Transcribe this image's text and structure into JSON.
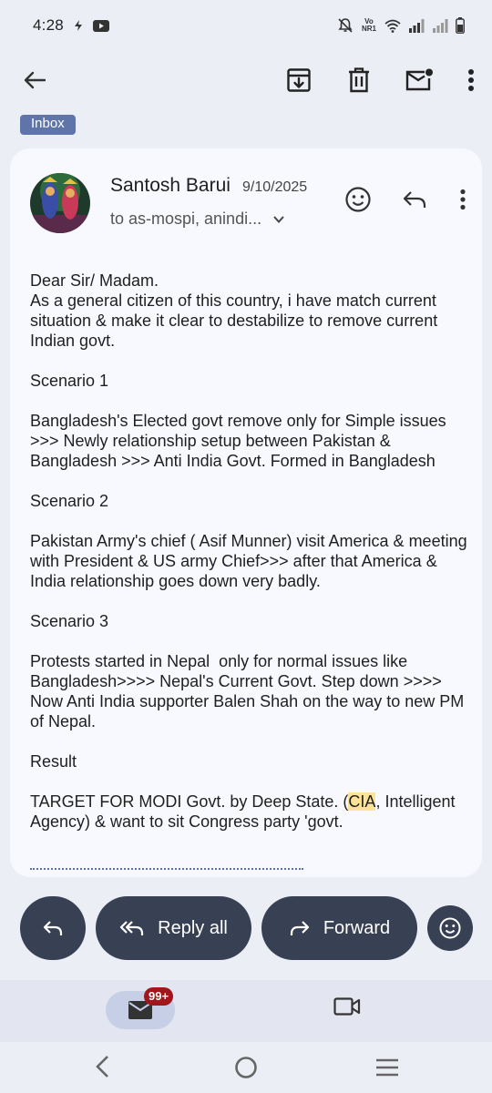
{
  "status_bar": {
    "time": "4:28",
    "network_label": "Vo NR1"
  },
  "app_bar": {
    "icons": [
      "back-arrow-icon",
      "archive-icon",
      "delete-icon",
      "mark-unread-icon",
      "more-vert-icon"
    ]
  },
  "label_chip": "Inbox",
  "email": {
    "sender": "Santosh Barui",
    "date": "9/10/2025",
    "recipients": "to as-mospi, anindi...",
    "body_lines": [
      "Dear Sir/ Madam.",
      "As a general citizen of this country, i have match current situation & make it clear to destabilize to remove current Indian govt.",
      "",
      "Scenario 1",
      "",
      "Bangladesh's Elected govt remove only for Simple issues >>> Newly relationship setup between Pakistan & Bangladesh >>> Anti India Govt. Formed in Bangladesh",
      "",
      "Scenario 2",
      "",
      "Pakistan Army's chief ( Asif Munner) visit America & meeting with President & US army Chief>>> after that America & India relationship goes down very badly.",
      "",
      "Scenario 3",
      "",
      "Protests started in Nepal  only for normal issues like Bangladesh>>>> Nepal's Current Govt. Step down >>>> Now Anti India supporter Balen Shah on the way to new PM of Nepal.",
      "",
      "Result",
      ""
    ],
    "final_line_before": "TARGET FOR MODI Govt. by Deep State. (",
    "final_line_highlight": "CIA",
    "final_line_after": ", Intelligent Agency) & want to sit Congress party 'govt."
  },
  "bottom_actions": {
    "reply_all_label": "Reply all",
    "forward_label": "Forward"
  },
  "bottom_nav": {
    "mail_badge": "99+"
  },
  "colors": {
    "background": "#eceef6",
    "card": "#f8f9fe",
    "pill": "#384053",
    "chip": "#5f74a8",
    "badge": "#a0161a",
    "highlight": "#fde39a"
  }
}
